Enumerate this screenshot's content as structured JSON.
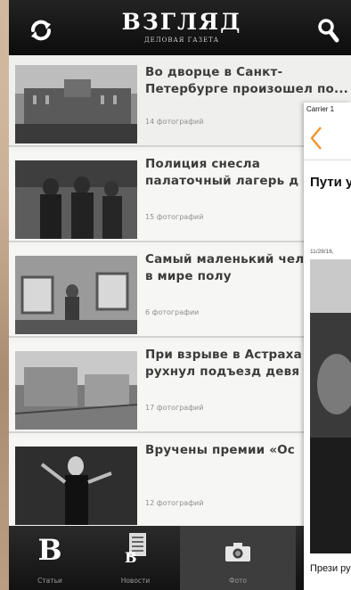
{
  "header": {
    "logo_main": "ВЗГЛЯД",
    "logo_sub": "ДЕЛОВАЯ ГАЗЕТА",
    "refresh_icon": "refresh-icon",
    "search_icon": "search-icon"
  },
  "feed": {
    "items": [
      {
        "title": "Во дворце в Санкт-Петербурге произошел по...",
        "count": "14 фотографий"
      },
      {
        "title": "Полиция снесла палаточный лагерь д",
        "count": "15 фотографий"
      },
      {
        "title": "Самый маленький человек в мире полу",
        "count": "6 фотографии"
      },
      {
        "title": "При взрыве в Астраха рухнул подъезд девя",
        "count": "17 фотографий"
      },
      {
        "title": "Вручены премии «Ос",
        "count": "12 фотографий"
      }
    ]
  },
  "tabbar": {
    "tabs": [
      {
        "label": "Статьи",
        "icon": "b-logo-icon"
      },
      {
        "label": "Новости",
        "icon": "news-icon"
      },
      {
        "label": "Фото",
        "icon": "camera-icon",
        "active": true
      }
    ]
  },
  "overlay": {
    "status_text": "Carrier 1",
    "back_icon": "chevron-left-icon",
    "headline": "Пути упра Мино",
    "date": "11/28/16,",
    "caption": "Прези руков",
    "accent_color": "#f0962e"
  },
  "colors": {
    "topbar": "#111111",
    "tabbar": "#1c1c1c",
    "feed_bg": "#f3f3f1",
    "title_text": "#3c3c3c"
  }
}
